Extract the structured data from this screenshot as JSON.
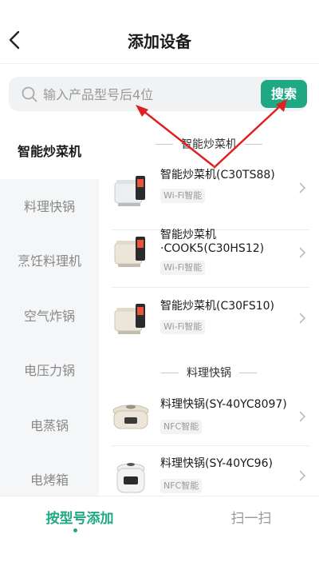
{
  "header": {
    "title": "添加设备"
  },
  "search": {
    "placeholder": "输入产品型号后4位",
    "button_label": "搜索"
  },
  "sidebar": {
    "items": [
      {
        "label": "智能炒菜机",
        "active": true
      },
      {
        "label": "料理快锅",
        "active": false
      },
      {
        "label": "烹饪料理机",
        "active": false
      },
      {
        "label": "空气炸锅",
        "active": false
      },
      {
        "label": "电压力锅",
        "active": false
      },
      {
        "label": "电蒸锅",
        "active": false
      },
      {
        "label": "电烤箱",
        "active": false
      }
    ]
  },
  "sections": [
    {
      "title": "智能炒菜机",
      "products": [
        {
          "name": "智能炒菜机(C30TS88)",
          "tag": "Wi-Fi智能",
          "icon": "stir-fry-machine-icon"
        },
        {
          "name_line1": "智能炒菜机",
          "name_line2": "·COOK5(C30HS12)",
          "tag": "Wi-Fi智能",
          "icon": "stir-fry-machine-icon"
        },
        {
          "name": "智能炒菜机(C30FS10)",
          "tag": "Wi-Fi智能",
          "icon": "stir-fry-machine-icon"
        }
      ]
    },
    {
      "title": "料理快锅",
      "products": [
        {
          "name": "料理快锅(SY-40YC8097)",
          "tag": "NFC智能",
          "icon": "pressure-cooker-icon"
        },
        {
          "name": "料理快锅(SY-40YC96)",
          "tag": "NFC智能",
          "icon": "pressure-cooker-icon"
        }
      ]
    }
  ],
  "tabbar": {
    "tabs": [
      {
        "label": "按型号添加",
        "active": true
      },
      {
        "label": "扫一扫",
        "active": false
      }
    ]
  },
  "colors": {
    "accent": "#1ea983",
    "annotation": "#e02020",
    "sidebar_bg": "#f5f6f7"
  }
}
